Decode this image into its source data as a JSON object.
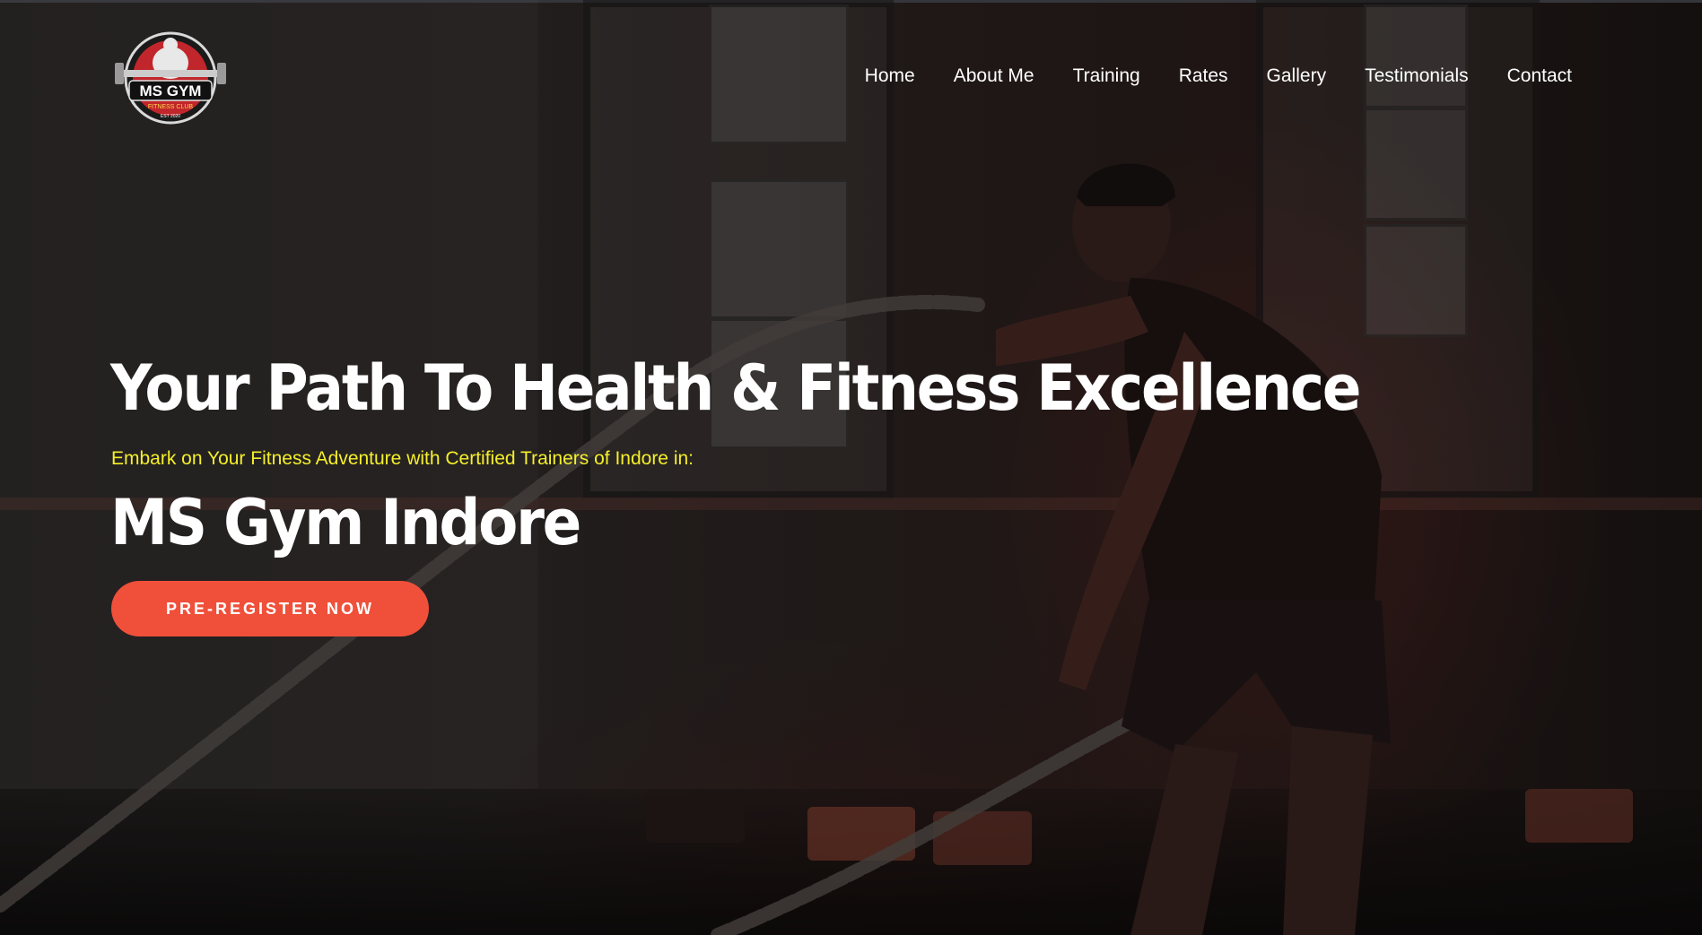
{
  "logo": {
    "main_text": "MS GYM",
    "ring_text": "FITNESS CLUB",
    "est_text": "EST 2020"
  },
  "nav": {
    "items": [
      {
        "label": "Home"
      },
      {
        "label": "About Me"
      },
      {
        "label": "Training"
      },
      {
        "label": "Rates"
      },
      {
        "label": "Gallery"
      },
      {
        "label": "Testimonials"
      },
      {
        "label": "Contact"
      }
    ]
  },
  "hero": {
    "headline": "Your Path To Health & Fitness Excellence",
    "tagline": "Embark on Your Fitness Adventure with Certified Trainers of Indore in:",
    "gym_name": "MS Gym Indore",
    "cta_label": "PRE-REGISTER NOW",
    "background_icon": "battle-rope-athlete-image"
  },
  "colors": {
    "accent": "#f0503a",
    "tagline": "#f5ef2a",
    "text": "#ffffff",
    "background": "#2a2524"
  }
}
